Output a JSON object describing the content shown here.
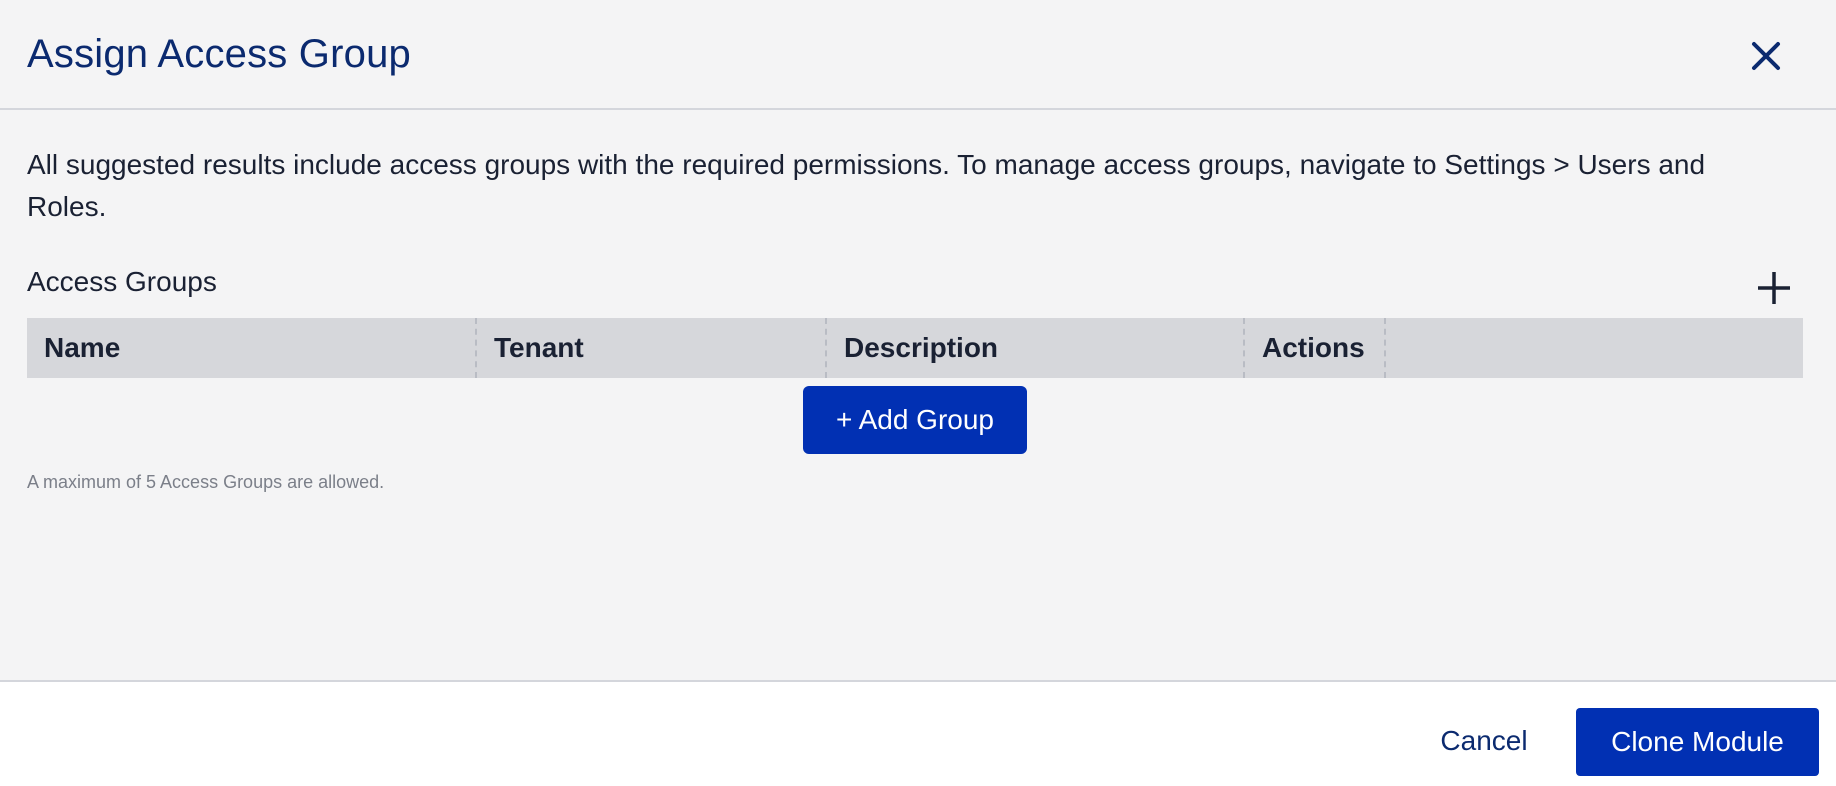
{
  "modal": {
    "title": "Assign Access Group",
    "close_icon": "close-icon"
  },
  "intro": {
    "text": "All suggested results include access groups with the required permissions. To manage access groups, navigate to Settings > Users and Roles."
  },
  "access_groups": {
    "label": "Access Groups",
    "add_icon": "plus-icon",
    "columns": [
      "Name",
      "Tenant",
      "Description",
      "Actions"
    ],
    "rows": [],
    "add_group_label": "+ Add Group",
    "helper_text": "A maximum of 5 Access Groups are allowed."
  },
  "footer": {
    "cancel_label": "Cancel",
    "clone_label": "Clone Module"
  },
  "colors": {
    "primary": "#0130b3",
    "title": "#0b2a6f",
    "header_bg": "#d6d7db",
    "background": "#f4f4f5"
  }
}
